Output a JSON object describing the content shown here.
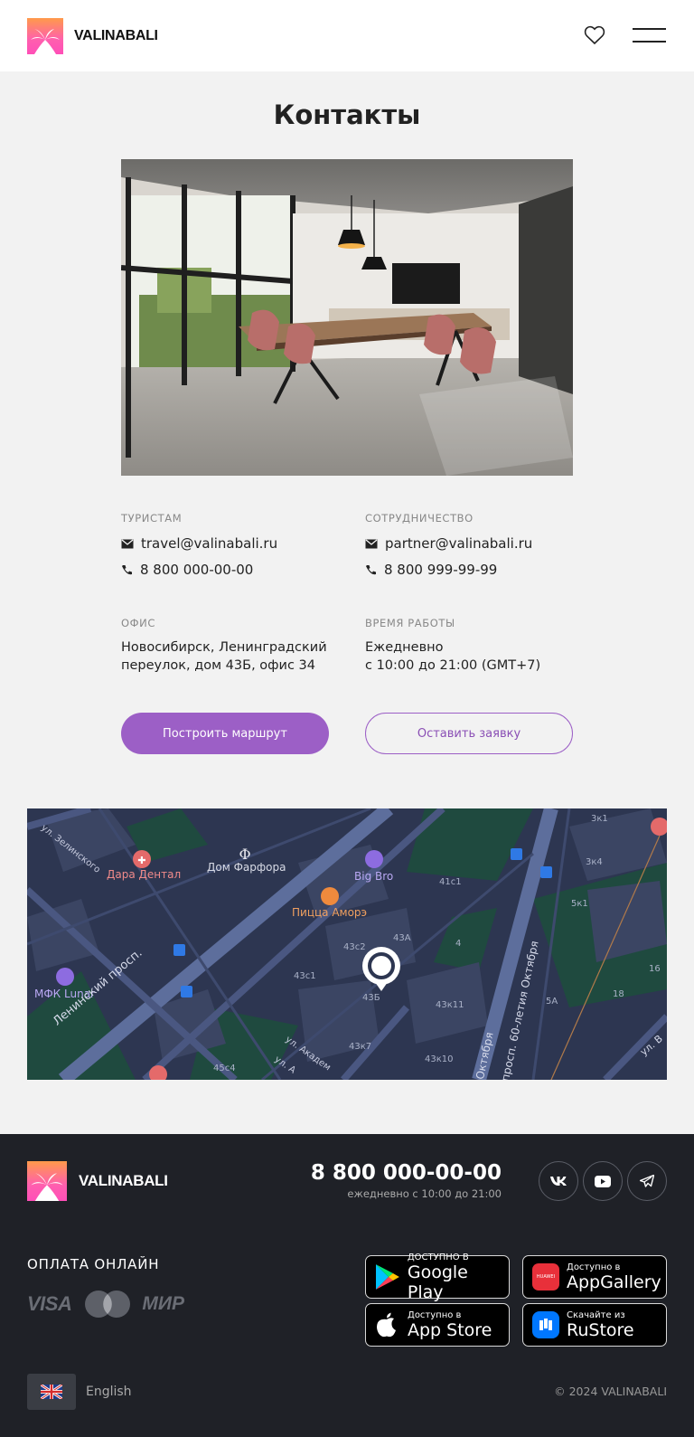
{
  "header": {
    "brand": "VALINABALI",
    "icons": [
      "palm-logo-icon",
      "heart-icon",
      "menu-icon"
    ]
  },
  "page": {
    "title": "Контакты"
  },
  "contacts": {
    "tourists": {
      "label": "ТУРИСТАМ",
      "email": "travel@valinabali.ru",
      "phone": "8 800 000-00-00"
    },
    "partners": {
      "label": "СОТРУДНИЧЕСТВО",
      "email": "partner@valinabali.ru",
      "phone": "8 800 999-99-99"
    },
    "office": {
      "label": "ОФИС",
      "line1": "Новосибирск, Ленинградский",
      "line2": "переулок, дом 43Б, офис 34"
    },
    "hours": {
      "label": "ВРЕМЯ РАБОТЫ",
      "line1": "Ежедневно",
      "line2": "с 10:00 до 21:00 (GMT+7)"
    }
  },
  "buttons": {
    "route": "Построить маршрут",
    "request": "Оставить заявку"
  },
  "map": {
    "places": {
      "dara": "Дара Дентал",
      "farfor": "Дом Фарфора",
      "bigbro": "Big Bro",
      "pizza": "Пицца Аморэ",
      "mfk": "МФК Lunar"
    },
    "houses": {
      "h41c1": "41с1",
      "h43c2": "43с2",
      "h43a": "43А",
      "h4": "4",
      "h43c1": "43с1",
      "h43b": "43Б",
      "h43k11": "43к11",
      "h43k7": "43к7",
      "h43k10": "43к10",
      "h45c4": "45с4",
      "h3k1": "3к1",
      "h3k4": "3к4",
      "h5k1": "5к1",
      "h16": "16",
      "h18": "18",
      "h5a": "5А"
    },
    "streets": {
      "leninsky": "Ленинский просп.",
      "zelinskogo": "ул. Зелинского",
      "oktyabrya": "просп. 60-летия Октября",
      "oktyabrya2": "Октября",
      "akadem": "ул. Академ",
      "akadem2": "ул. А",
      "uv": "ул. В"
    }
  },
  "footer": {
    "brand": "VALINABALI",
    "phone": "8 800 000-00-00",
    "phone_hours": "ежедневно с 10:00 до 21:00",
    "social": [
      "vk-icon",
      "youtube-icon",
      "telegram-icon"
    ],
    "payment_title": "ОПЛАТА ОНЛАЙН",
    "payment_methods": {
      "visa": "VISA",
      "mir": "МИР"
    },
    "stores": {
      "google_small": "ДОСТУПНО В",
      "google_big": "Google Play",
      "huawei_small": "Доступно в",
      "huawei_big": "AppGallery",
      "huawei_badge": "HUAWEI",
      "apple_small": "Доступно в",
      "apple_big": "App Store",
      "rustore_small": "Скачайте из",
      "rustore_big": "RuStore"
    },
    "language": "English",
    "copyright": "© 2024 VALINABALI"
  }
}
